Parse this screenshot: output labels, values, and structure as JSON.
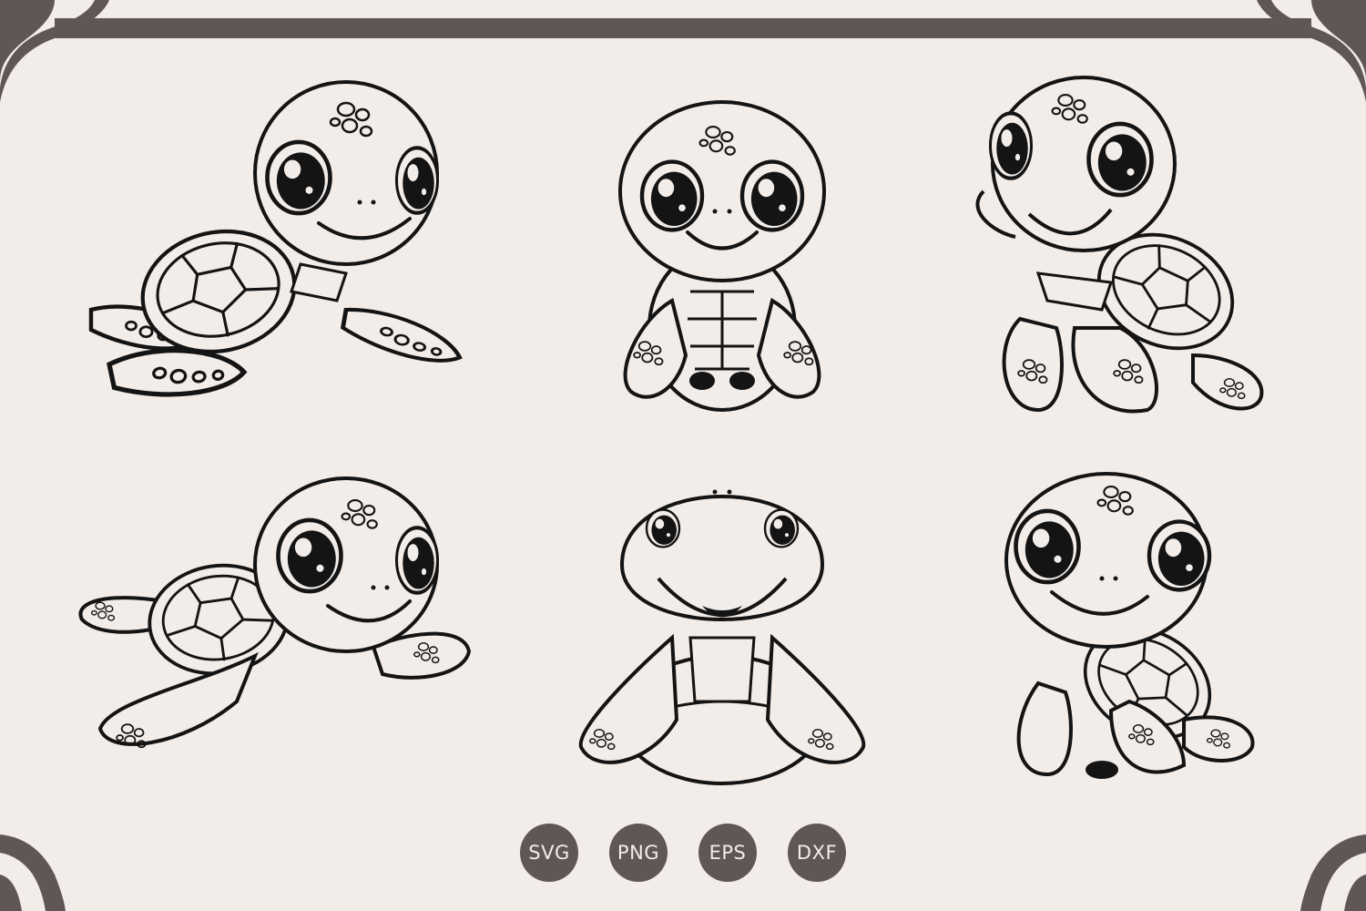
{
  "colors": {
    "background": "#f3ede9",
    "frame": "#615656",
    "ink": "#141414",
    "badge": "#615656"
  },
  "illustrations": [
    {
      "name": "turtle-swimming-left",
      "icon": "sea-turtle-icon"
    },
    {
      "name": "turtle-sitting-front",
      "icon": "sea-turtle-icon"
    },
    {
      "name": "turtle-looking-up",
      "icon": "sea-turtle-icon"
    },
    {
      "name": "turtle-swimming-wide",
      "icon": "sea-turtle-icon"
    },
    {
      "name": "turtle-smiling-front",
      "icon": "sea-turtle-icon"
    },
    {
      "name": "turtle-standing-side",
      "icon": "sea-turtle-icon"
    }
  ],
  "formats": [
    "SVG",
    "PNG",
    "EPS",
    "DXF"
  ]
}
